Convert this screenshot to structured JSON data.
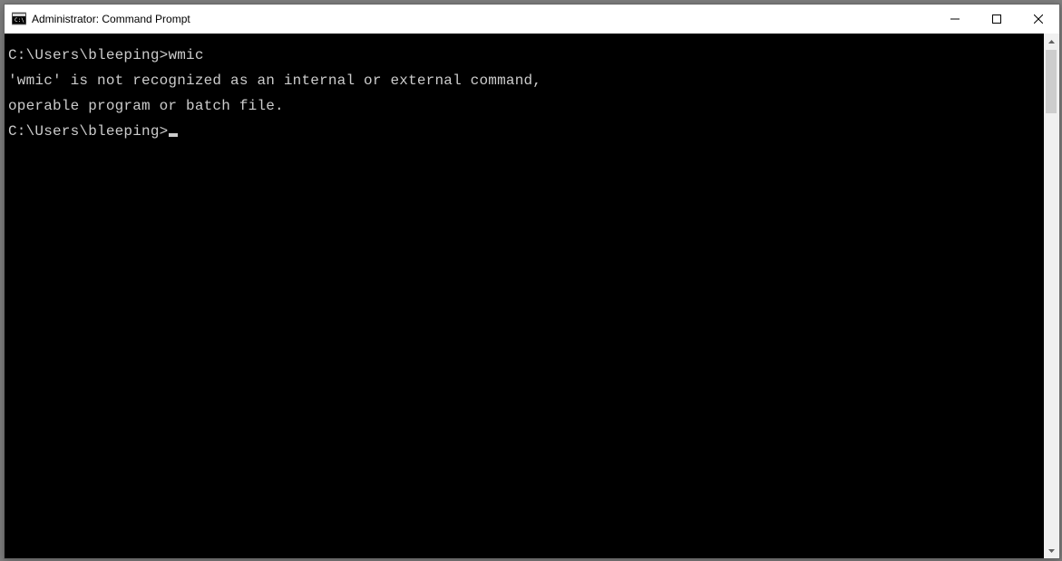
{
  "window": {
    "title": "Administrator: Command Prompt"
  },
  "terminal": {
    "lines": [
      {
        "prompt": "C:\\Users\\bleeping>",
        "command": "wmic"
      },
      {
        "text": "'wmic' is not recognized as an internal or external command,"
      },
      {
        "text": "operable program or batch file."
      },
      {
        "text": ""
      },
      {
        "prompt": "C:\\Users\\bleeping>",
        "has_cursor": true
      }
    ]
  }
}
